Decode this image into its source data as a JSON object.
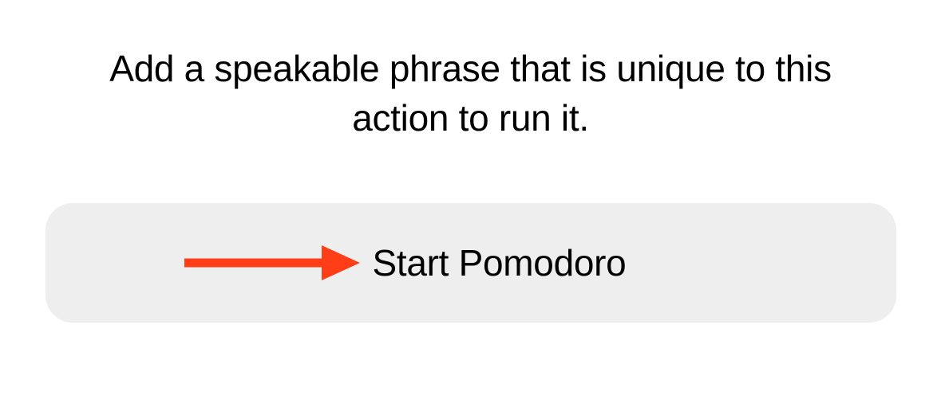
{
  "instruction_text": "Add a speakable phrase that is unique to this action to run it.",
  "phrase_input": {
    "value": "Start Pomodoro"
  },
  "annotation": {
    "color": "#ff3d16"
  }
}
